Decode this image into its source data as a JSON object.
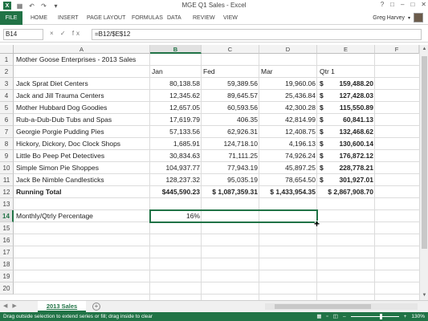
{
  "window": {
    "title": "MGE Q1 Sales - Excel",
    "controls": [
      "?",
      "□",
      "–",
      "□",
      "✕"
    ]
  },
  "qat": {
    "logo": "X",
    "icons": [
      "save-icon",
      "undo-icon",
      "redo-icon",
      "customize-icon"
    ]
  },
  "ribbon": {
    "tabs": [
      "FILE",
      "HOME",
      "INSERT",
      "PAGE LAYOUT",
      "FORMULAS",
      "DATA",
      "REVIEW",
      "VIEW"
    ],
    "user": "Greg Harvey"
  },
  "formula_bar": {
    "name_box": "B14",
    "icons": "× ✓ fx",
    "formula": "=B12/$E$12"
  },
  "columns": [
    "A",
    "B",
    "C",
    "D",
    "E",
    "F"
  ],
  "selected_column": "B",
  "rows": [
    "1",
    "2",
    "3",
    "4",
    "5",
    "6",
    "7",
    "8",
    "9",
    "10",
    "11",
    "12",
    "13",
    "14",
    "15",
    "16",
    "17",
    "18",
    "19",
    "20"
  ],
  "selected_row": "14",
  "sheet": {
    "title": "Mother Goose Enterprises - 2013 Sales",
    "headers": [
      "Jan",
      "Fed",
      "Mar",
      "Qtr 1"
    ],
    "data": [
      {
        "name": "Jack Sprat Diet Centers",
        "jan": "80,138.58",
        "feb": "59,389.56",
        "mar": "19,960.06",
        "qtr": "159,488.20"
      },
      {
        "name": "Jack and Jill Trauma Centers",
        "jan": "12,345.62",
        "feb": "89,645.57",
        "mar": "25,436.84",
        "qtr": "127,428.03"
      },
      {
        "name": "Mother Hubbard Dog Goodies",
        "jan": "12,657.05",
        "feb": "60,593.56",
        "mar": "42,300.28",
        "qtr": "115,550.89"
      },
      {
        "name": "Rub-a-Dub-Dub Tubs and Spas",
        "jan": "17,619.79",
        "feb": "406.35",
        "mar": "42,814.99",
        "qtr": "60,841.13"
      },
      {
        "name": "Georgie Porgie Pudding Pies",
        "jan": "57,133.56",
        "feb": "62,926.31",
        "mar": "12,408.75",
        "qtr": "132,468.62"
      },
      {
        "name": "Hickory, Dickory, Doc Clock Shops",
        "jan": "1,685.91",
        "feb": "124,718.10",
        "mar": "4,196.13",
        "qtr": "130,600.14"
      },
      {
        "name": "Little Bo Peep Pet Detectives",
        "jan": "30,834.63",
        "feb": "71,111.25",
        "mar": "74,926.24",
        "qtr": "176,872.12"
      },
      {
        "name": "Simple Simon Pie Shoppes",
        "jan": "104,937.77",
        "feb": "77,943.19",
        "mar": "45,897.25",
        "qtr": "228,778.21"
      },
      {
        "name": "Jack Be Nimble Candlesticks",
        "jan": "128,237.32",
        "feb": "95,035.19",
        "mar": "78,654.50",
        "qtr": "301,927.01"
      }
    ],
    "currency_symbol": "$",
    "total": {
      "label": "Running Total",
      "jan": "$445,590.23",
      "feb": "$ 1,087,359.31",
      "mar": "$ 1,433,954.35",
      "qtr": "$ 2,867,908.70"
    },
    "pct_label": "Monthly/Qtrly Percentage",
    "pct_value": "16%"
  },
  "sheet_tabs": {
    "active": "2013 Sales",
    "add": "+"
  },
  "status_bar": {
    "message": "Drag outside selection to extend series or fill; drag inside to clear",
    "zoom_out": "–",
    "zoom_in": "+",
    "zoom": "130%"
  },
  "colors": {
    "accent": "#217346"
  }
}
